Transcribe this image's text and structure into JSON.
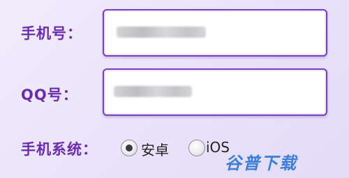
{
  "form": {
    "phone_label": "手机号：",
    "qq_label": "QQ号：",
    "system_label": "手机系统：",
    "system_options": [
      {
        "label": "安卓",
        "selected": true
      },
      {
        "label": "iOS",
        "selected": false
      }
    ]
  },
  "watermark": {
    "text": "谷普下载",
    "color": "#3a7fd9"
  }
}
